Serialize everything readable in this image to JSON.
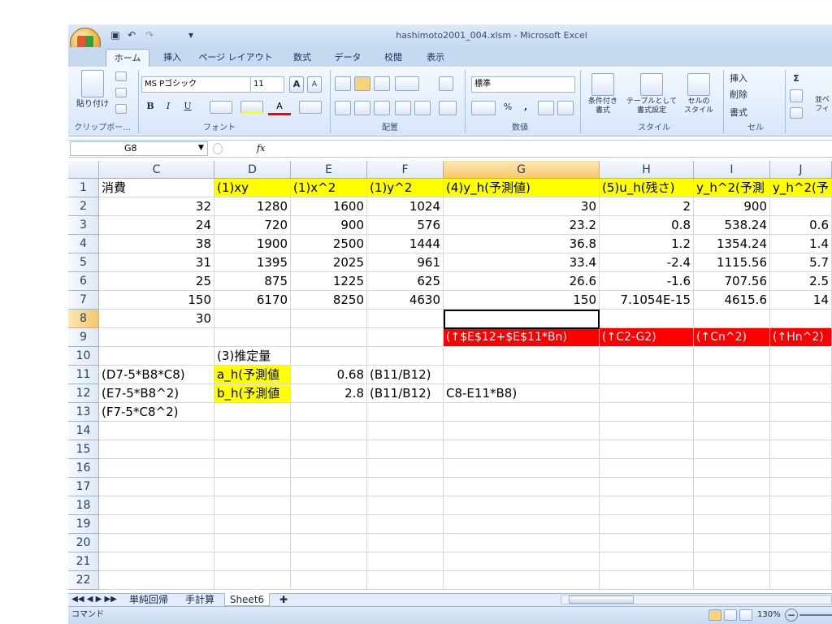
{
  "window": {
    "title": "hashimoto2001_004.xlsm - Microsoft Excel"
  },
  "qat": {
    "save": "▣",
    "undo": "↶",
    "redo": "↷",
    "more": "▾"
  },
  "tabs": [
    "ホーム",
    "挿入",
    "ページ レイアウト",
    "数式",
    "データ",
    "校閲",
    "表示"
  ],
  "ribbon": {
    "paste_label": "貼り付け",
    "clipboard_label": "クリップボー...",
    "font_name": "MS Pゴシック",
    "font_size": "11",
    "bold": "B",
    "italic": "I",
    "underline": "U",
    "font_label": "フォント",
    "align_label": "配置",
    "number_format": "標準",
    "number_label": "数値",
    "percent": "%",
    "comma": ",",
    "cond_format": "条件付き\n書式",
    "table_format": "テーブルとして\n書式設定",
    "cell_style": "セルの\nスタイル",
    "style_label": "スタイル",
    "insert": "挿入",
    "delete": "削除",
    "format": "書式",
    "cells_label": "セル",
    "sigma": "Σ",
    "sort_label": "並べ\nフィ"
  },
  "formula_bar": {
    "name_box": "G8",
    "fx": "fx",
    "formula": ""
  },
  "columns": [
    "C",
    "D",
    "E",
    "F",
    "G",
    "H",
    "I",
    "J"
  ],
  "rows": [
    "1",
    "2",
    "3",
    "4",
    "5",
    "6",
    "7",
    "8",
    "9",
    "10",
    "11",
    "12",
    "13",
    "14",
    "15",
    "16",
    "17",
    "18",
    "19",
    "20",
    "21",
    "22"
  ],
  "cells": {
    "r1": [
      "消費",
      "(1)xy",
      "(1)x^2",
      "(1)y^2",
      "(4)y_h(予測値)",
      "(5)u_h(残さ)",
      "y_h^2(予測",
      "y_h^2(予"
    ],
    "r2": [
      "32",
      "1280",
      "1600",
      "1024",
      "30",
      "2",
      "900",
      ""
    ],
    "r3": [
      "24",
      "720",
      "900",
      "576",
      "23.2",
      "0.8",
      "538.24",
      "0.6"
    ],
    "r4": [
      "38",
      "1900",
      "2500",
      "1444",
      "36.8",
      "1.2",
      "1354.24",
      "1.4"
    ],
    "r5": [
      "31",
      "1395",
      "2025",
      "961",
      "33.4",
      "-2.4",
      "1115.56",
      "5.7"
    ],
    "r6": [
      "25",
      "875",
      "1225",
      "625",
      "26.6",
      "-1.6",
      "707.56",
      "2.5"
    ],
    "r7": [
      "150",
      "6170",
      "8250",
      "4630",
      "150",
      "7.1054E-15",
      "4615.6",
      "14"
    ],
    "r8": [
      "30"
    ],
    "r9": [
      "(↑$E$12+$E$11*Bn)",
      "(↑C2-G2)",
      "(↑Cn^2)",
      "(↑Hn^2)"
    ],
    "r10": [
      "(3)推定量"
    ],
    "r11": [
      "(D7-5*B8*C8)",
      "a_h(予測値",
      "0.68",
      "(B11/B12)"
    ],
    "r12": [
      "(E7-5*B8^2)",
      "b_h(予測値",
      "2.8",
      "(B11/B12)",
      "C8-E11*B8)"
    ],
    "r13": [
      "(F7-5*C8^2)"
    ]
  },
  "sheets": [
    "単純回帰",
    "手計算",
    "Sheet6"
  ],
  "status": {
    "mode": "コマンド",
    "zoom": "130%"
  }
}
